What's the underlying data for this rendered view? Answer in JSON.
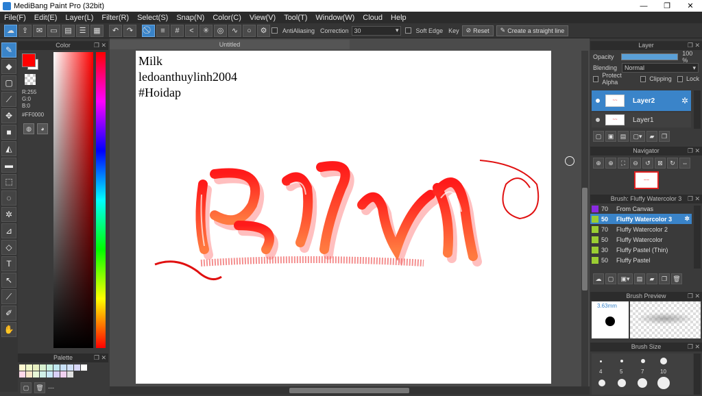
{
  "window": {
    "title": "MediBang Paint Pro (32bit)",
    "min": "—",
    "max": "❐",
    "close": "✕"
  },
  "menu": [
    "File(F)",
    "Edit(E)",
    "Layer(L)",
    "Filter(R)",
    "Select(S)",
    "Snap(N)",
    "Color(C)",
    "View(V)",
    "Tool(T)",
    "Window(W)",
    "Cloud",
    "Help"
  ],
  "toolbar": {
    "antialiasing": "AntiAliasing",
    "correction_label": "Correction",
    "correction_value": "30",
    "soft_edge": "Soft Edge",
    "key": "Key",
    "reset": "Reset",
    "straight_line": "Create a straight line"
  },
  "color_panel": {
    "title": "Color",
    "r": "R:255",
    "g": "G:0",
    "b": "B:0",
    "hex": "#FF0000",
    "fg_color": "#ff0000"
  },
  "palette": {
    "title": "Palette",
    "footer": "---"
  },
  "canvas": {
    "tab": "Untitled",
    "text_lines": [
      "Milk",
      "ledoanthuylinh2004",
      "#Hoidap"
    ]
  },
  "layer_panel": {
    "title": "Layer",
    "opacity_label": "Opacity",
    "opacity_value": "100 %",
    "blending_label": "Blending",
    "blending_value": "Normal",
    "protect_alpha": "Protect Alpha",
    "clipping": "Clipping",
    "lock": "Lock",
    "layers": [
      "Layer2",
      "Layer1"
    ]
  },
  "navigator": {
    "title": "Navigator"
  },
  "brush_panel": {
    "title": "Brush: Fluffy Watercolor 3",
    "items": [
      {
        "size": "70",
        "name": "From Canvas",
        "color": "#8a2be2"
      },
      {
        "size": "50",
        "name": "Fluffy Watercolor 3",
        "color": "#9acd32",
        "selected": true
      },
      {
        "size": "70",
        "name": "Fluffy Watercolor 2",
        "color": "#9acd32"
      },
      {
        "size": "50",
        "name": "Fluffy Watercolor",
        "color": "#9acd32"
      },
      {
        "size": "30",
        "name": "Fluffy Pastel (Thin)",
        "color": "#9acd32"
      },
      {
        "size": "50",
        "name": "Fluffy Pastel",
        "color": "#9acd32"
      }
    ]
  },
  "brush_preview": {
    "title": "Brush Preview",
    "size": "3.63mm"
  },
  "brush_size": {
    "title": "Brush Size",
    "sizes": [
      "4",
      "5",
      "7",
      "10"
    ]
  }
}
